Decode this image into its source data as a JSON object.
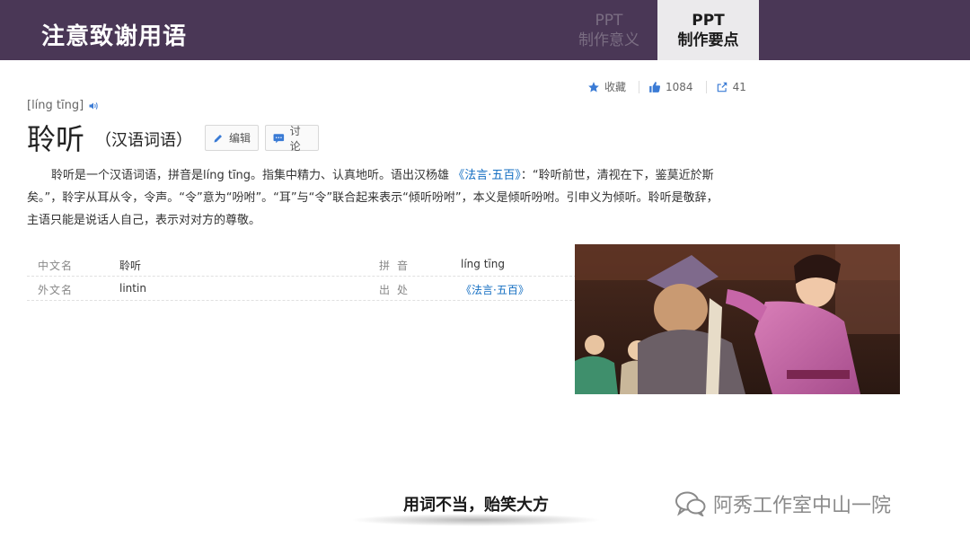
{
  "header": {
    "title": "注意致谢用语",
    "tabs": [
      {
        "line1": "PPT",
        "line2": "制作意义",
        "active": false
      },
      {
        "line1": "PPT",
        "line2": "制作要点",
        "active": true
      }
    ]
  },
  "stats": {
    "favorite_label": "收藏",
    "likes": "1084",
    "shares": "41"
  },
  "entry": {
    "pinyin": "[líng tīng]",
    "title": "聆听",
    "subtitle": "（汉语词语）",
    "edit_label": "编辑",
    "discuss_label": "讨论",
    "summary_part1": "聆听是一个汉语词语，拼音是líng tīng。指集中精力、认真地听。语出汉杨雄 ",
    "summary_link": "《法言·五百》",
    "summary_part2": "：“聆听前世，清视在下，鉴莫近於斯矣。”，聆字从耳从令，令声。“令”意为“吩咐”。“耳”与“令”联合起来表示“倾听吩咐”，本义是倾听吩咐。引申义为倾听。聆听是敬辞，主语只能是说话人自己，表示对对方的尊敬。"
  },
  "info": {
    "rows": [
      {
        "label1": "中文名",
        "value1": "聆听",
        "label2": "拼音",
        "value2": "líng tīng"
      },
      {
        "label1": "外文名",
        "value1": "lintin",
        "label2": "出处",
        "value2": "《法言·五百》"
      }
    ]
  },
  "footer": {
    "slogan": "用词不当，贻笑大方",
    "watermark": "阿秀工作室中山一院"
  },
  "colors": {
    "header_bg": "#4a3756",
    "active_tab_bg": "#ebeaec",
    "link": "#136ec2",
    "icon_blue": "#3a7bd5"
  }
}
